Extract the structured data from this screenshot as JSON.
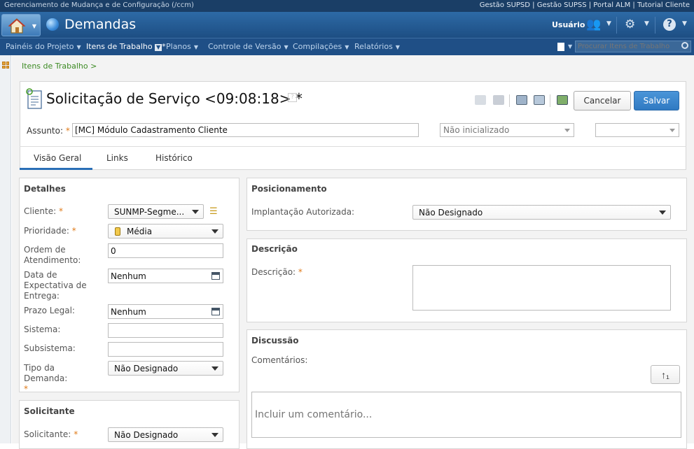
{
  "top_strip": {
    "context": "Gerenciamento de Mudança e de Configuração (/ccm)",
    "links": "Gestão SUPSD | Gestão SUPSS | Portal ALM | Tutorial Cliente"
  },
  "banner": {
    "app_title": "Demandas",
    "user_label": "Usuário"
  },
  "nav": {
    "items": [
      "Painéis do Projeto",
      "Itens de Trabalho",
      "Planos",
      "Controle de Versão",
      "Compilações",
      "Relatórios"
    ],
    "current_marker": "*",
    "search_placeholder": "Procurar Itens de Trabalho"
  },
  "breadcrumb": "Itens de Trabalho >",
  "work_item": {
    "title": "Solicitação de Serviço <09:08:18>",
    "dirty_marker": "*",
    "help": "?",
    "cancel_label": "Cancelar",
    "save_label": "Salvar",
    "subject_label": "Assunto:",
    "subject_value": "[MC] Módulo Cadastramento Cliente",
    "state_value": "Não inicializado",
    "resolution_value": ""
  },
  "tabs": [
    "Visão Geral",
    "Links",
    "Histórico"
  ],
  "details": {
    "title": "Detalhes",
    "cliente_label": "Cliente:",
    "cliente_value": "SUNMP-Segme...",
    "prioridade_label": "Prioridade:",
    "prioridade_value": "Média",
    "ordem_label": "Ordem de Atendimento:",
    "ordem_value": "0",
    "data_label": "Data de Expectativa de Entrega:",
    "data_value": "Nenhum",
    "prazo_label": "Prazo Legal:",
    "prazo_value": "Nenhum",
    "sistema_label": "Sistema:",
    "sistema_value": "",
    "subsistema_label": "Subsistema:",
    "subsistema_value": "",
    "tipo_label": "Tipo da Demanda:",
    "tipo_value": "Não Designado"
  },
  "requester": {
    "title": "Solicitante",
    "solicitante_label": "Solicitante:",
    "solicitante_value": "Não Designado"
  },
  "positioning": {
    "title": "Posicionamento",
    "implantacao_label": "Implantação Autorizada:",
    "implantacao_value": "Não Designado"
  },
  "description": {
    "title": "Descrição",
    "descricao_label": "Descrição:",
    "descricao_value": ""
  },
  "discussion": {
    "title": "Discussão",
    "comments_label": "Comentários:",
    "comment_placeholder": "Incluir um comentário...",
    "sort_label": "↑₁"
  },
  "required_marker": "*",
  "colors": {
    "banner": "#2d6aa6",
    "nav": "#1f4f86",
    "required": "#e07b1a",
    "save": "#3a86cc",
    "breadcrumb": "#3b8a22"
  }
}
